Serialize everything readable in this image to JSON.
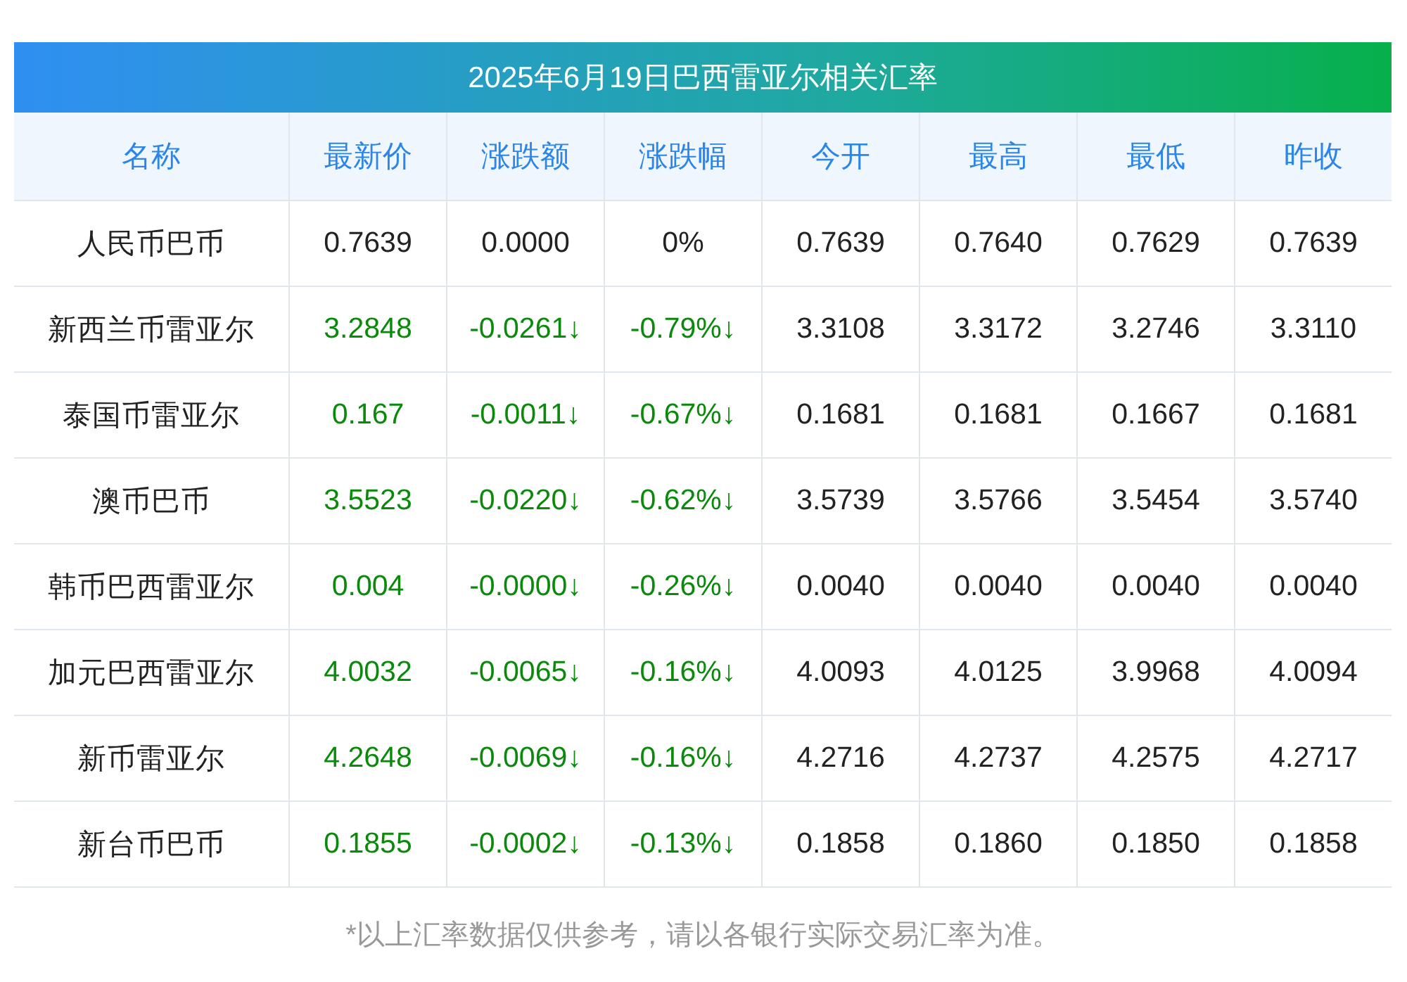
{
  "title": "2025年6月19日巴西雷亚尔相关汇率",
  "columns": [
    "名称",
    "最新价",
    "涨跌额",
    "涨跌幅",
    "今开",
    "最高",
    "最低",
    "昨收"
  ],
  "rows": [
    {
      "color": "#222222",
      "cells": [
        "人民币巴币",
        "0.7639",
        "0.0000",
        "0%",
        "0.7639",
        "0.7640",
        "0.7629",
        "0.7639"
      ]
    },
    {
      "color": "#0a8a0a",
      "cells": [
        "新西兰币雷亚尔",
        "3.2848",
        "-0.0261↓",
        "-0.79%↓",
        "3.3108",
        "3.3172",
        "3.2746",
        "3.3110"
      ]
    },
    {
      "color": "#0a8a0a",
      "cells": [
        "泰国币雷亚尔",
        "0.167",
        "-0.0011↓",
        "-0.67%↓",
        "0.1681",
        "0.1681",
        "0.1667",
        "0.1681"
      ]
    },
    {
      "color": "#0a8a0a",
      "cells": [
        "澳币巴币",
        "3.5523",
        "-0.0220↓",
        "-0.62%↓",
        "3.5739",
        "3.5766",
        "3.5454",
        "3.5740"
      ]
    },
    {
      "color": "#0a8a0a",
      "cells": [
        "韩币巴西雷亚尔",
        "0.004",
        "-0.0000↓",
        "-0.26%↓",
        "0.0040",
        "0.0040",
        "0.0040",
        "0.0040"
      ]
    },
    {
      "color": "#0a8a0a",
      "cells": [
        "加元巴西雷亚尔",
        "4.0032",
        "-0.0065↓",
        "-0.16%↓",
        "4.0093",
        "4.0125",
        "3.9968",
        "4.0094"
      ]
    },
    {
      "color": "#0a8a0a",
      "cells": [
        "新币雷亚尔",
        "4.2648",
        "-0.0069↓",
        "-0.16%↓",
        "4.2716",
        "4.2737",
        "4.2575",
        "4.2717"
      ]
    },
    {
      "color": "#0a8a0a",
      "cells": [
        "新台币巴币",
        "0.1855",
        "-0.0002↓",
        "-0.13%↓",
        "0.1858",
        "0.1860",
        "0.1850",
        "0.1858"
      ]
    }
  ],
  "footnote": "*以上汇率数据仅供参考，请以各银行实际交易汇率为准。"
}
